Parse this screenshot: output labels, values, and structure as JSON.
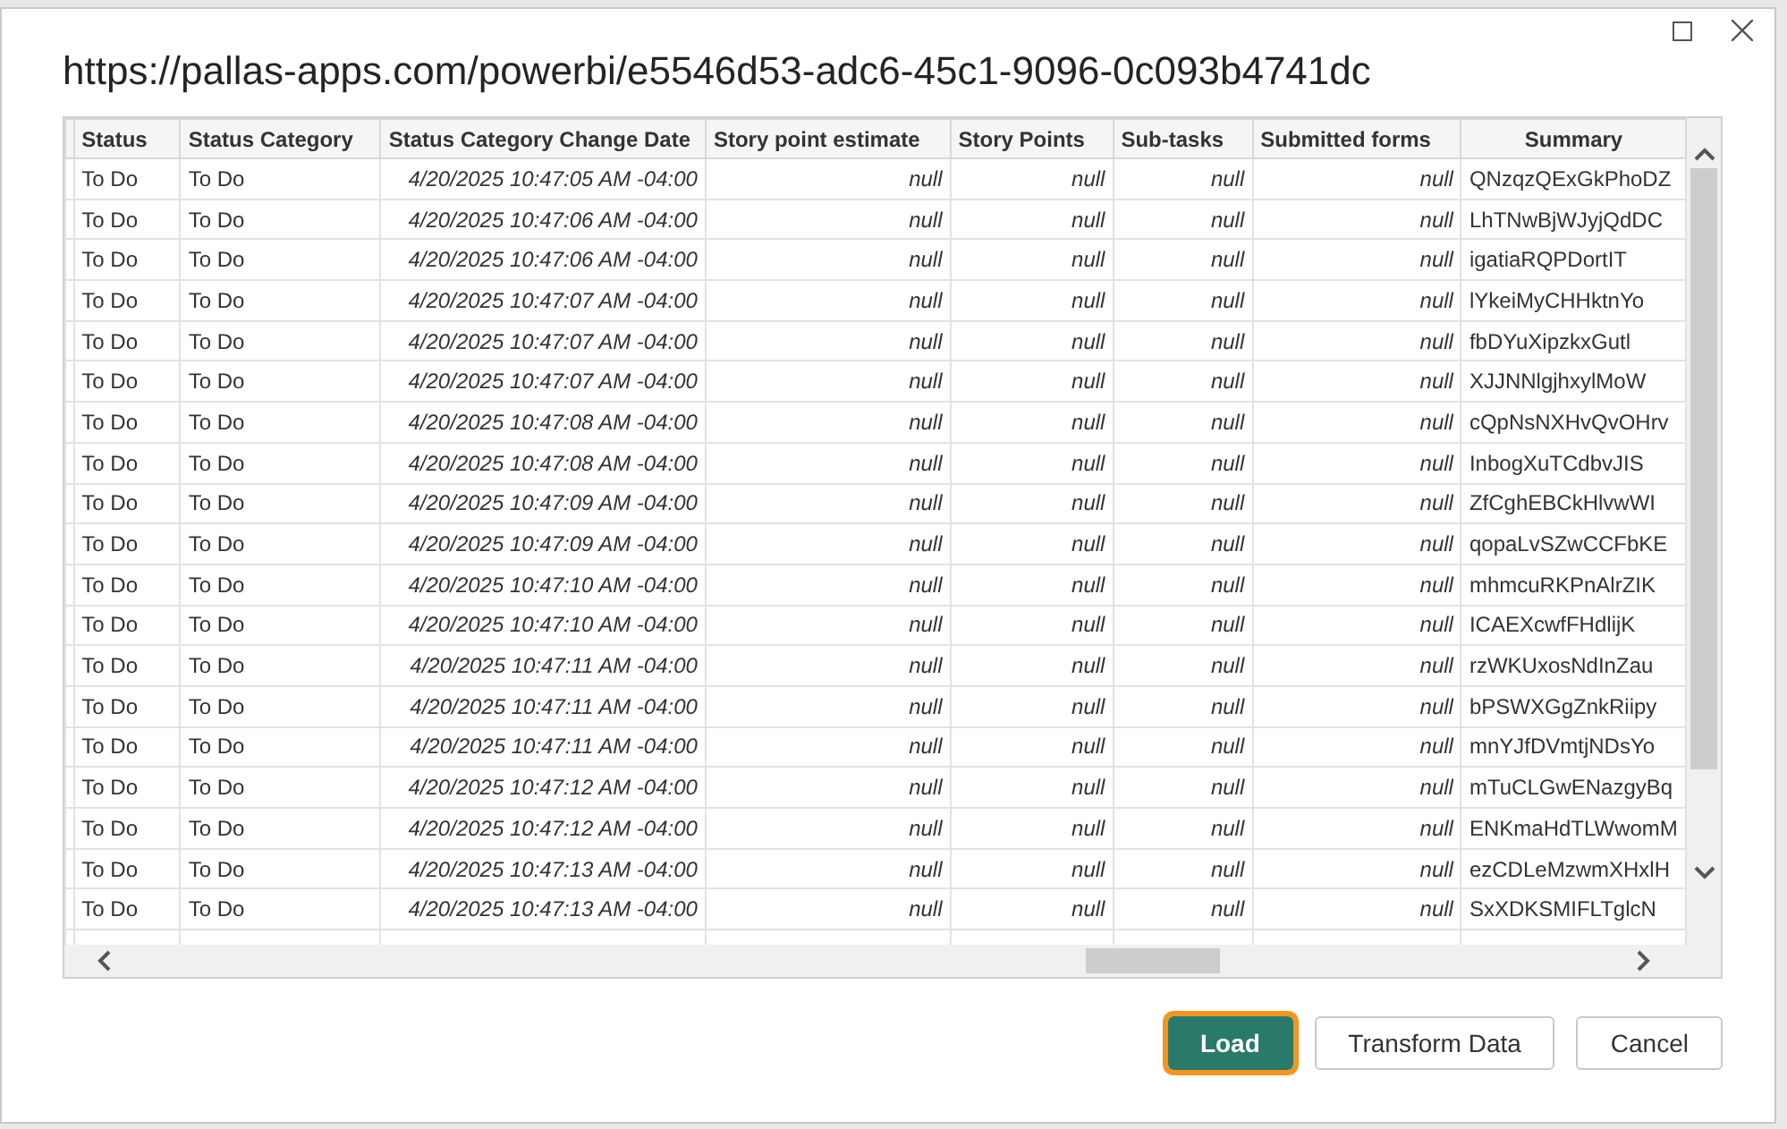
{
  "dialog": {
    "title": "https://pallas-apps.com/powerbi/e5546d53-adc6-45c1-9096-0c093b4741dc"
  },
  "table": {
    "columns": [
      "Status",
      "Status Category",
      "Status Category Change Date",
      "Story point estimate",
      "Story Points",
      "Sub-tasks",
      "Submitted forms",
      "Summary"
    ],
    "rows": [
      [
        "To Do",
        "To Do",
        "4/20/2025 10:47:05 AM -04:00",
        "null",
        "null",
        "null",
        "null",
        "QNzqzQExGkPhoDZ"
      ],
      [
        "To Do",
        "To Do",
        "4/20/2025 10:47:06 AM -04:00",
        "null",
        "null",
        "null",
        "null",
        "LhTNwBjWJyjQdDC"
      ],
      [
        "To Do",
        "To Do",
        "4/20/2025 10:47:06 AM -04:00",
        "null",
        "null",
        "null",
        "null",
        "igatiaRQPDortIT"
      ],
      [
        "To Do",
        "To Do",
        "4/20/2025 10:47:07 AM -04:00",
        "null",
        "null",
        "null",
        "null",
        "lYkeiMyCHHktnYo"
      ],
      [
        "To Do",
        "To Do",
        "4/20/2025 10:47:07 AM -04:00",
        "null",
        "null",
        "null",
        "null",
        "fbDYuXipzkxGutl"
      ],
      [
        "To Do",
        "To Do",
        "4/20/2025 10:47:07 AM -04:00",
        "null",
        "null",
        "null",
        "null",
        "XJJNNlgjhxylMoW"
      ],
      [
        "To Do",
        "To Do",
        "4/20/2025 10:47:08 AM -04:00",
        "null",
        "null",
        "null",
        "null",
        "cQpNsNXHvQvOHrv"
      ],
      [
        "To Do",
        "To Do",
        "4/20/2025 10:47:08 AM -04:00",
        "null",
        "null",
        "null",
        "null",
        "InbogXuTCdbvJIS"
      ],
      [
        "To Do",
        "To Do",
        "4/20/2025 10:47:09 AM -04:00",
        "null",
        "null",
        "null",
        "null",
        "ZfCghEBCkHlvwWI"
      ],
      [
        "To Do",
        "To Do",
        "4/20/2025 10:47:09 AM -04:00",
        "null",
        "null",
        "null",
        "null",
        "qopaLvSZwCCFbKE"
      ],
      [
        "To Do",
        "To Do",
        "4/20/2025 10:47:10 AM -04:00",
        "null",
        "null",
        "null",
        "null",
        "mhmcuRKPnAlrZIK"
      ],
      [
        "To Do",
        "To Do",
        "4/20/2025 10:47:10 AM -04:00",
        "null",
        "null",
        "null",
        "null",
        "ICAEXcwfFHdlijK"
      ],
      [
        "To Do",
        "To Do",
        "4/20/2025 10:47:11 AM -04:00",
        "null",
        "null",
        "null",
        "null",
        "rzWKUxosNdInZau"
      ],
      [
        "To Do",
        "To Do",
        "4/20/2025 10:47:11 AM -04:00",
        "null",
        "null",
        "null",
        "null",
        "bPSWXGgZnkRiipy"
      ],
      [
        "To Do",
        "To Do",
        "4/20/2025 10:47:11 AM -04:00",
        "null",
        "null",
        "null",
        "null",
        "mnYJfDVmtjNDsYo"
      ],
      [
        "To Do",
        "To Do",
        "4/20/2025 10:47:12 AM -04:00",
        "null",
        "null",
        "null",
        "null",
        "mTuCLGwENazgyBq"
      ],
      [
        "To Do",
        "To Do",
        "4/20/2025 10:47:12 AM -04:00",
        "null",
        "null",
        "null",
        "null",
        "ENKmaHdTLWwomM"
      ],
      [
        "To Do",
        "To Do",
        "4/20/2025 10:47:13 AM -04:00",
        "null",
        "null",
        "null",
        "null",
        "ezCDLeMzwmXHxlH"
      ],
      [
        "To Do",
        "To Do",
        "4/20/2025 10:47:13 AM -04:00",
        "null",
        "null",
        "null",
        "null",
        "SxXDKSMIFLTglcN"
      ]
    ]
  },
  "buttons": [
    {
      "label": "Load",
      "kind": "primary",
      "focused": true
    },
    {
      "label": "Transform Data",
      "kind": "default",
      "focused": false
    },
    {
      "label": "Cancel",
      "kind": "default",
      "focused": false
    }
  ]
}
